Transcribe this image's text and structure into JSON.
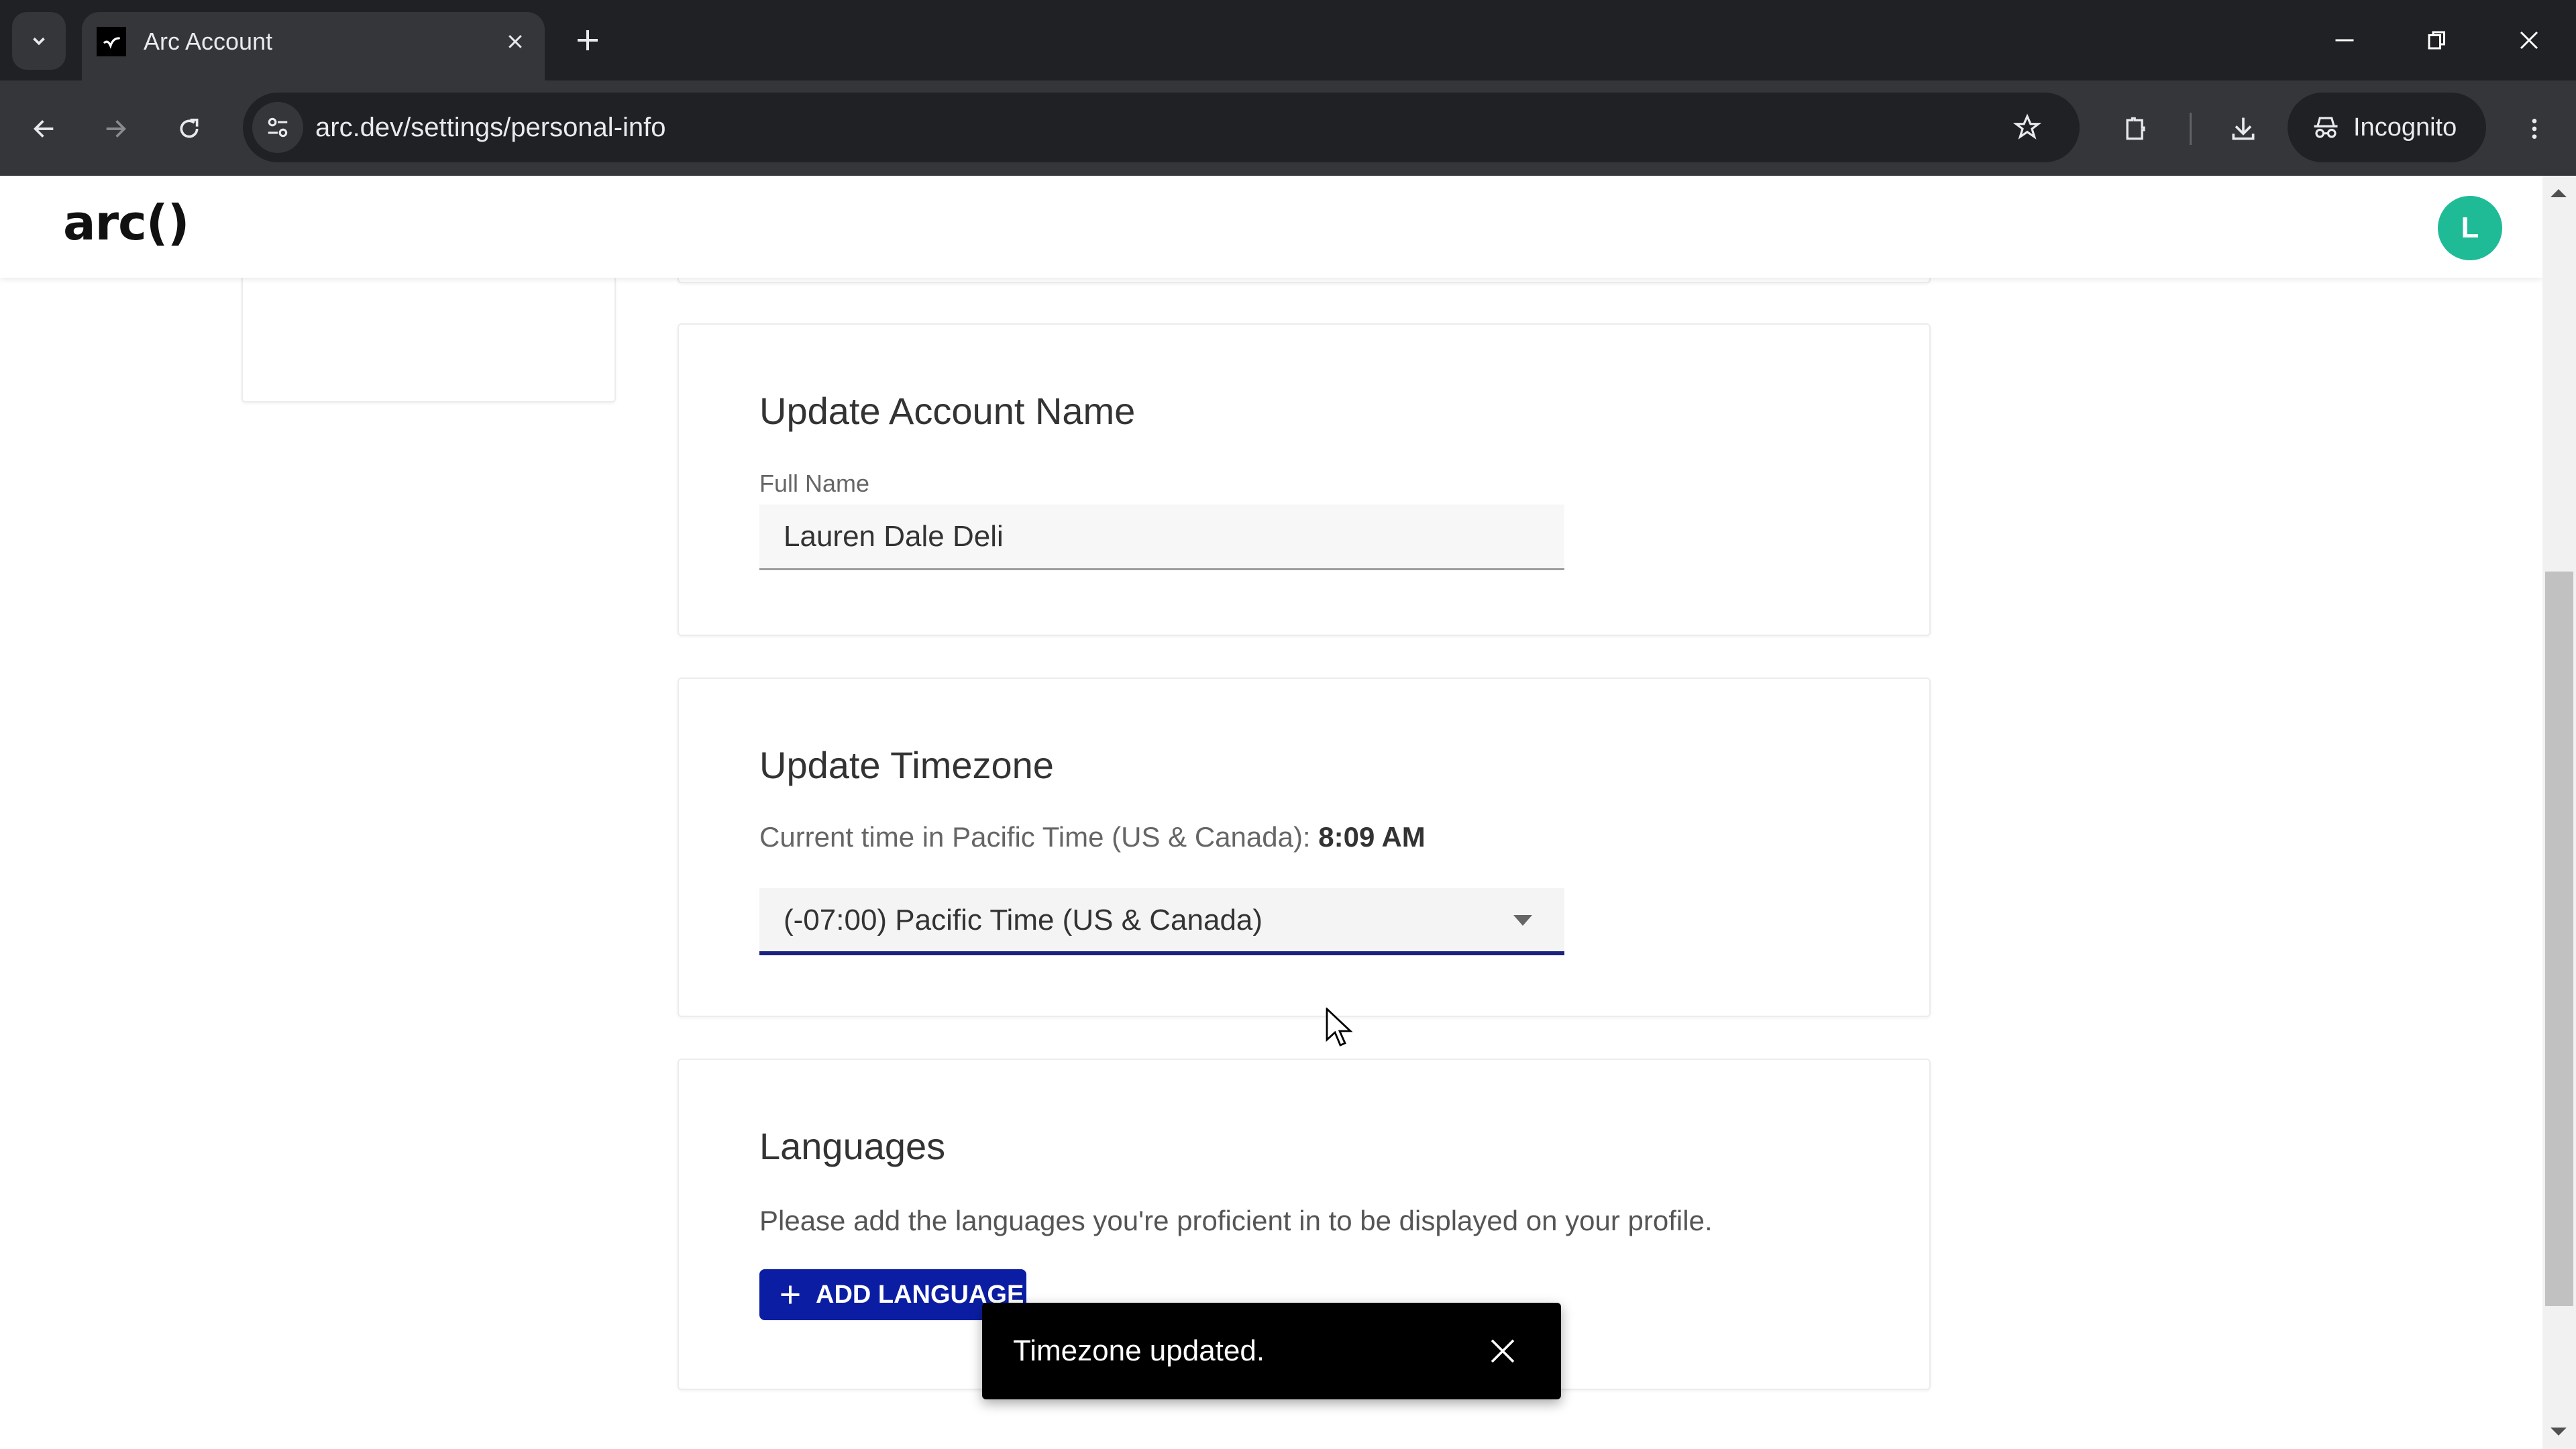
{
  "browser": {
    "tab": {
      "title": "Arc Account",
      "favicon": "arc-favicon-icon"
    },
    "url": "arc.dev/settings/personal-info",
    "profile_label": "Incognito",
    "icons": [
      "tab-search-icon",
      "close-icon",
      "plus-icon",
      "minimize-icon",
      "restore-icon",
      "window-close-icon",
      "back-arrow-icon",
      "forward-arrow-icon",
      "reload-icon",
      "site-info-icon",
      "star-icon",
      "extensions-icon",
      "download-icon",
      "incognito-icon",
      "kebab-menu-icon"
    ]
  },
  "header": {
    "logo": "arc()",
    "avatar_initial": "L",
    "avatar_color": "#1fbb96"
  },
  "account_name": {
    "title": "Update Account Name",
    "field_label": "Full Name",
    "value": "Lauren Dale Deli"
  },
  "timezone": {
    "title": "Update Timezone",
    "current_time_prefix": "Current time in Pacific Time (US & Canada):",
    "current_time": "8:09 AM",
    "selected": "(-07:00) Pacific Time (US & Canada)"
  },
  "languages": {
    "title": "Languages",
    "description": "Please add the languages you're proficient in to be displayed on your profile.",
    "add_button": "ADD LANGUAGE"
  },
  "toast": {
    "message": "Timezone updated."
  },
  "scroll": {
    "thumb_start_fraction": 0.3,
    "thumb_end_fraction": 0.91
  },
  "colors": {
    "accent_blue": "#0b1ea3",
    "select_underline": "#1a237e",
    "toast_bg": "#000000"
  }
}
